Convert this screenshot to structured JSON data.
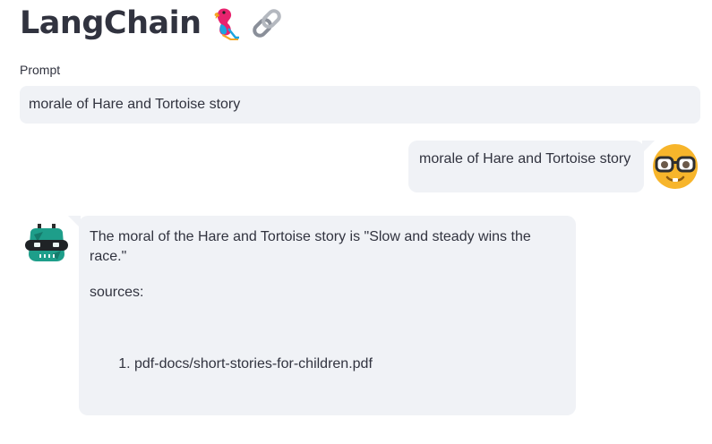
{
  "header": {
    "title": "LangChain",
    "icons": [
      "parrot-icon",
      "link-icon"
    ]
  },
  "prompt": {
    "label": "Prompt",
    "value": "morale of Hare and Tortoise story"
  },
  "conversation": {
    "user_message": "morale of Hare and Tortoise story",
    "user_avatar": "nerd-face-emoji",
    "bot_avatar": "robot-avatar",
    "bot_answer": "The moral of the Hare and Tortoise story is \"Slow and steady wins the race.\"",
    "sources_label": "sources:",
    "sources": [
      "pdf-docs/short-stories-for-children.pdf"
    ]
  },
  "colors": {
    "bubble_bg": "#f0f2f6",
    "text": "#31333f",
    "avatar_yellow": "#f7b52b",
    "bot_teal": "#1e9e8a"
  }
}
